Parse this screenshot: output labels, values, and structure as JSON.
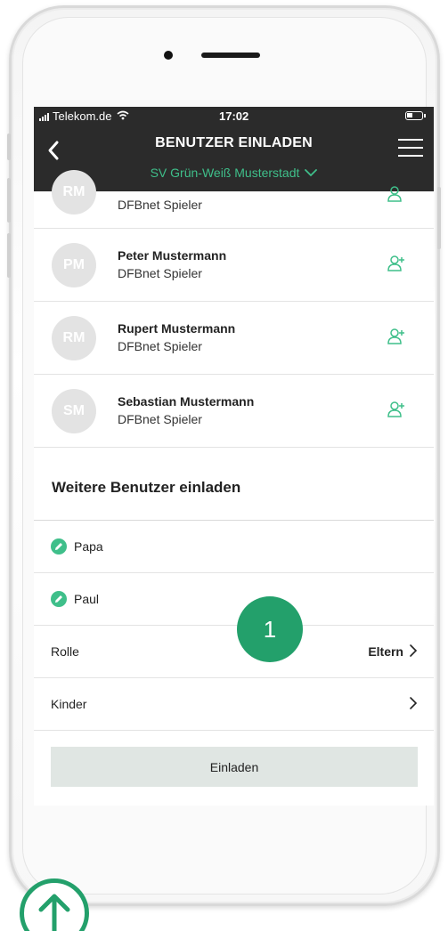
{
  "status_bar": {
    "carrier": "Telekom.de",
    "time": "17:02"
  },
  "navbar": {
    "title": "BENUTZER EINLADEN",
    "club": "SV Grün-Weiß Musterstadt"
  },
  "users": [
    {
      "initials": "RM",
      "name": "",
      "role": "DFBnet Spieler",
      "partial": true
    },
    {
      "initials": "PM",
      "name": "Peter Mustermann",
      "role": "DFBnet Spieler"
    },
    {
      "initials": "RM",
      "name": "Rupert Mustermann",
      "role": "DFBnet Spieler"
    },
    {
      "initials": "SM",
      "name": "Sebastian Mustermann",
      "role": "DFBnet Spieler"
    }
  ],
  "invite_section": {
    "title": "Weitere Benutzer einladen",
    "first_name": "Papa",
    "last_name": "Paul",
    "role_label": "Rolle",
    "role_value": "Eltern",
    "children_label": "Kinder",
    "button_label": "Einladen"
  },
  "step_badge": "1",
  "colors": {
    "accent_green": "#3fbf8a",
    "badge_green": "#23a06b",
    "navbar_bg": "#2b2b2b",
    "button_bg": "#e0e6e3"
  },
  "icons": [
    "back-icon",
    "menu-icon",
    "chevron-down-icon",
    "add-user-icon",
    "edit-icon",
    "chevron-right-icon",
    "arrow-up-icon",
    "wifi-icon",
    "battery-icon",
    "signal-icon"
  ]
}
